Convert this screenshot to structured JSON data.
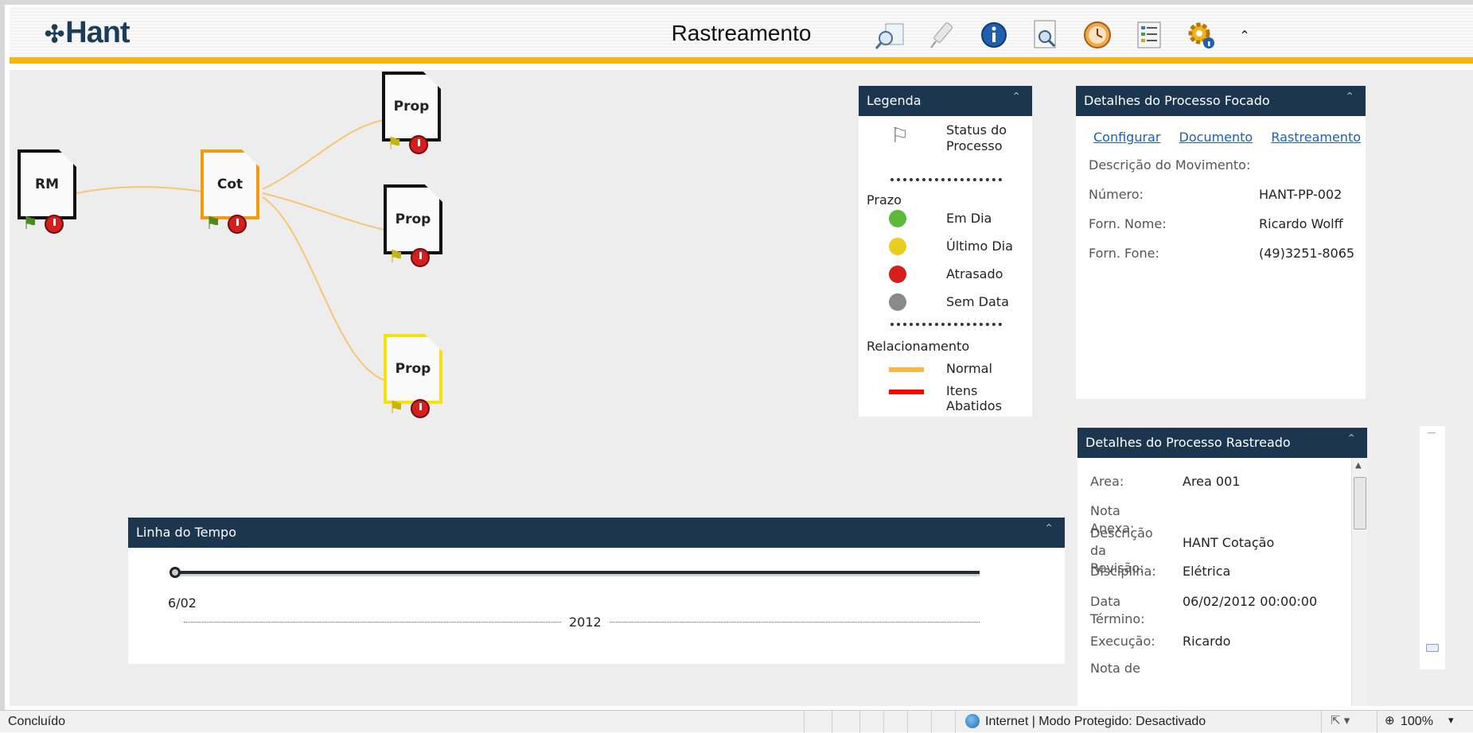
{
  "header": {
    "logo": "Hant",
    "title": "Rastreamento"
  },
  "toolbar": {
    "icons": [
      "search-document-icon",
      "brush-icon",
      "info-icon",
      "preview-icon",
      "clock-icon",
      "list-icon",
      "settings-icon"
    ],
    "collapse_glyph": "⌃"
  },
  "graph": {
    "nodes": [
      {
        "label": "RM"
      },
      {
        "label": "Cot"
      },
      {
        "label": "Prop"
      },
      {
        "label": "Prop"
      },
      {
        "label": "Prop"
      }
    ],
    "link_color": "#f7c673"
  },
  "legend": {
    "title": "Legenda",
    "status": "Status do Processo",
    "prazo_title": "Prazo",
    "prazo_items": [
      {
        "label": "Em Dia",
        "color": "#5db93a"
      },
      {
        "label": "Último Dia",
        "color": "#e8cf1d"
      },
      {
        "label": "Atrasado",
        "color": "#d41f1f"
      },
      {
        "label": "Sem Data",
        "color": "#8a8a8a"
      }
    ],
    "rel_title": "Relacionamento",
    "rel_items": [
      {
        "label": "Normal",
        "color": "#f7b84a"
      },
      {
        "label": "Itens Abatidos",
        "color": "#ff0000"
      }
    ]
  },
  "focused": {
    "title": "Detalhes do Processo Focado",
    "links": [
      "Configurar",
      "Documento",
      "Rastreamento"
    ],
    "desc_label": "Descrição do Movimento:",
    "fields": [
      {
        "label": "Número:",
        "value": "HANT-PP-002"
      },
      {
        "label": "Forn. Nome:",
        "value": "Ricardo Wolff"
      },
      {
        "label": "Forn. Fone:",
        "value": "(49)3251-8065"
      }
    ]
  },
  "tracked": {
    "title": "Detalhes do Processo Rastreado",
    "fields": [
      {
        "label": "Area:",
        "value": "Area 001"
      },
      {
        "label": "Nota Anexa:",
        "value": ""
      },
      {
        "label": "Descrição da Revisão:",
        "value": "HANT Cotação"
      },
      {
        "label": "Disciplina:",
        "value": "Elétrica"
      },
      {
        "label": "Data Término:",
        "value": "06/02/2012 00:00:00"
      },
      {
        "label": "Execução:",
        "value": "Ricardo"
      },
      {
        "label": "Nota de",
        "value": ""
      }
    ]
  },
  "timeline": {
    "title": "Linha do Tempo",
    "date_label": "6/02",
    "year_label": "2012"
  },
  "statusbar": {
    "left": "Concluído",
    "zone": "Internet | Modo Protegido: Desactivado",
    "zoom": "100%"
  }
}
